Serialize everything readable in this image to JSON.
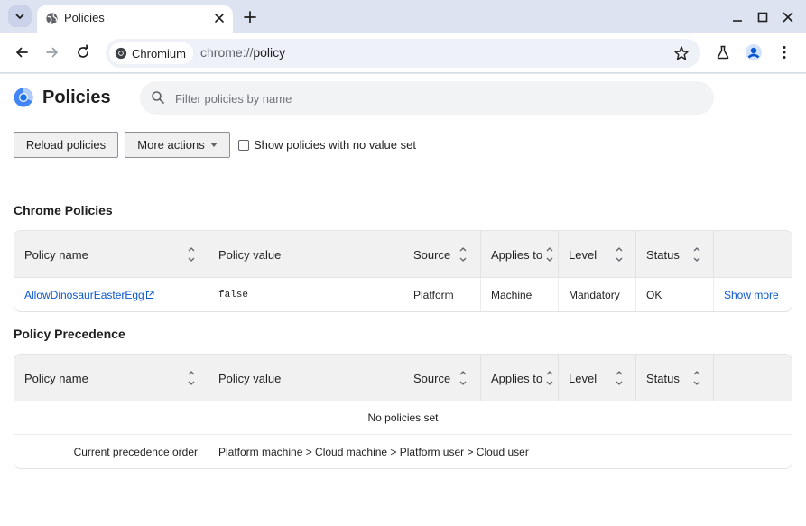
{
  "tab": {
    "title": "Policies"
  },
  "omnibox": {
    "chip_label": "Chromium",
    "url_scheme": "chrome://",
    "url_path": "policy"
  },
  "page": {
    "title": "Policies"
  },
  "search": {
    "placeholder": "Filter policies by name"
  },
  "actions": {
    "reload_label": "Reload policies",
    "more_label": "More actions",
    "show_unset_label": "Show policies with no value set"
  },
  "chrome_policies": {
    "title": "Chrome Policies",
    "headers": [
      "Policy name",
      "Policy value",
      "Source",
      "Applies to",
      "Level",
      "Status"
    ],
    "rows": [
      {
        "name": "AllowDinosaurEasterEgg",
        "value": "false",
        "source": "Platform",
        "applies_to": "Machine",
        "level": "Mandatory",
        "status": "OK",
        "action": "Show more"
      }
    ]
  },
  "precedence": {
    "title": "Policy Precedence",
    "headers": [
      "Policy name",
      "Policy value",
      "Source",
      "Applies to",
      "Level",
      "Status"
    ],
    "empty_label": "No policies set",
    "order_label": "Current precedence order",
    "order_value": "Platform machine > Cloud machine > Platform user > Cloud user"
  },
  "colors": {
    "accent": "#0b57d0",
    "tabstrip": "#dee3f2",
    "omnibox": "#eef1f8"
  },
  "icons": [
    "chevron-down-icon",
    "globe-icon",
    "close-icon",
    "plus-icon",
    "minimize-icon",
    "maximize-icon",
    "back-icon",
    "forward-icon",
    "reload-icon",
    "chromium-icon",
    "star-icon",
    "flask-icon",
    "profile-icon",
    "more-vert-icon",
    "search-icon",
    "sort-icon",
    "external-link-icon"
  ]
}
